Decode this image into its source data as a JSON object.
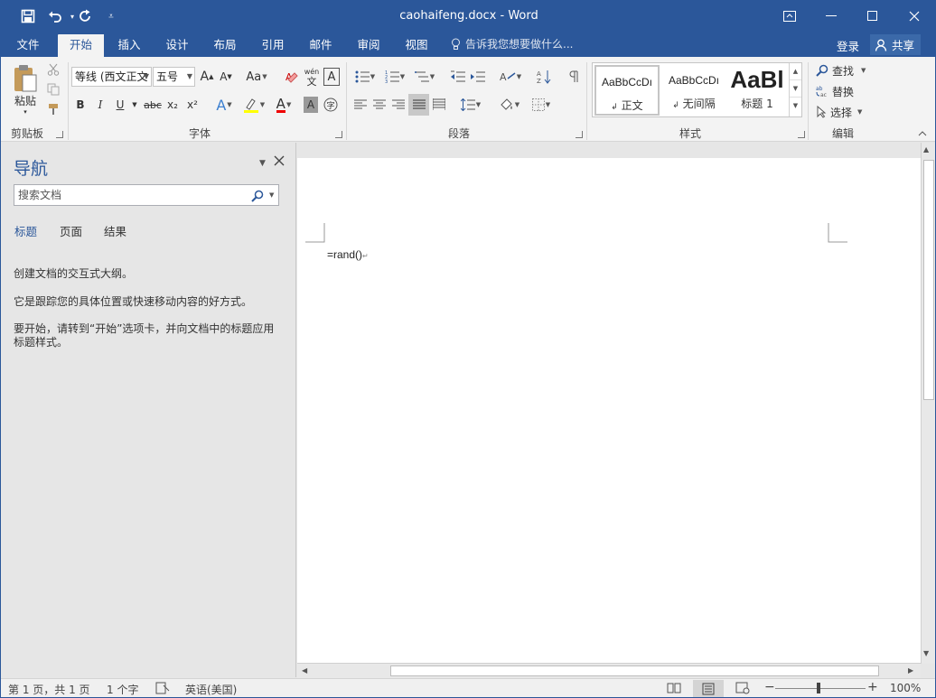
{
  "title_bar": {
    "document_title": "caohaifeng.docx - Word",
    "quick_access": [
      "save-icon",
      "undo-icon",
      "redo-icon",
      "customize-icon"
    ],
    "accent": "#2b579a"
  },
  "menu_tabs": [
    "文件",
    "开始",
    "插入",
    "设计",
    "布局",
    "引用",
    "邮件",
    "审阅",
    "视图"
  ],
  "active_tab": "开始",
  "tell_me": "告诉我您想要做什么...",
  "account": {
    "login": "登录",
    "share": "共享"
  },
  "ribbon": {
    "clipboard": {
      "label": "剪贴板",
      "paste": "粘贴"
    },
    "font": {
      "label": "字体",
      "font_name": "等线 (西文正文",
      "font_size": "五号",
      "grow": "A",
      "shrink": "A",
      "case": "Aa",
      "bold": "B",
      "italic": "I",
      "underline": "U",
      "strike": "abc",
      "subscript": "x₂",
      "superscript": "x²",
      "phonetic_top": "wén",
      "phonetic_bottom": "文",
      "font_color_glyph": "A",
      "char_border": "A"
    },
    "paragraph": {
      "label": "段落"
    },
    "styles": {
      "label": "样式",
      "items": [
        {
          "sample": "AaBbCcDı",
          "name": "正文",
          "selected": true
        },
        {
          "sample": "AaBbCcDı",
          "name": "无间隔",
          "selected": false
        },
        {
          "sample": "AaBl",
          "name": "标题 1",
          "selected": false
        }
      ]
    },
    "editing": {
      "label": "编辑",
      "find": "查找",
      "replace": "替换",
      "select": "选择"
    }
  },
  "nav_pane": {
    "title": "导航",
    "search_placeholder": "搜索文档",
    "tabs": [
      "标题",
      "页面",
      "结果"
    ],
    "active_tab": "标题",
    "hint_1": "创建文档的交互式大纲。",
    "hint_2": "它是跟踪您的具体位置或快速移动内容的好方式。",
    "hint_3": "要开始，请转到“开始”选项卡，并向文档中的标题应用标题样式。"
  },
  "document": {
    "text": "=rand()",
    "paragraph_mark": "↵"
  },
  "status_bar": {
    "page": "第 1 页，共 1 页",
    "words": "1 个字",
    "language": "英语(美国)",
    "zoom": "100%",
    "zoom_minus": "−",
    "zoom_plus": "+"
  }
}
